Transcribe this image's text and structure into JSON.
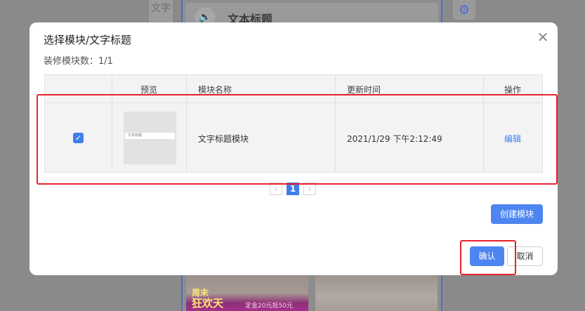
{
  "background": {
    "side_char": "文字",
    "title_text": "文本标题",
    "promo_line1": "周末",
    "promo_line2": "狂欢天",
    "promo_tag": "定金20元抵50元"
  },
  "modal": {
    "title": "选择模块/文字标题",
    "count_label": "装修模块数：",
    "count_value": "1/1",
    "close_glyph": "✕"
  },
  "table": {
    "headers": [
      "",
      "预览",
      "模块名称",
      "更新时间",
      "操作"
    ],
    "rows": [
      {
        "checked": true,
        "thumb_text": "文本标题",
        "name": "文字标题模块",
        "updated": "2021/1/29 下午2:12:49",
        "action": "编辑"
      }
    ]
  },
  "pagination": {
    "prev": "‹",
    "current": "1",
    "next": "›"
  },
  "buttons": {
    "create": "创建模块",
    "confirm": "确认",
    "cancel": "取消"
  },
  "colors": {
    "primary": "#4d86f0",
    "highlight": "#e8202a"
  }
}
